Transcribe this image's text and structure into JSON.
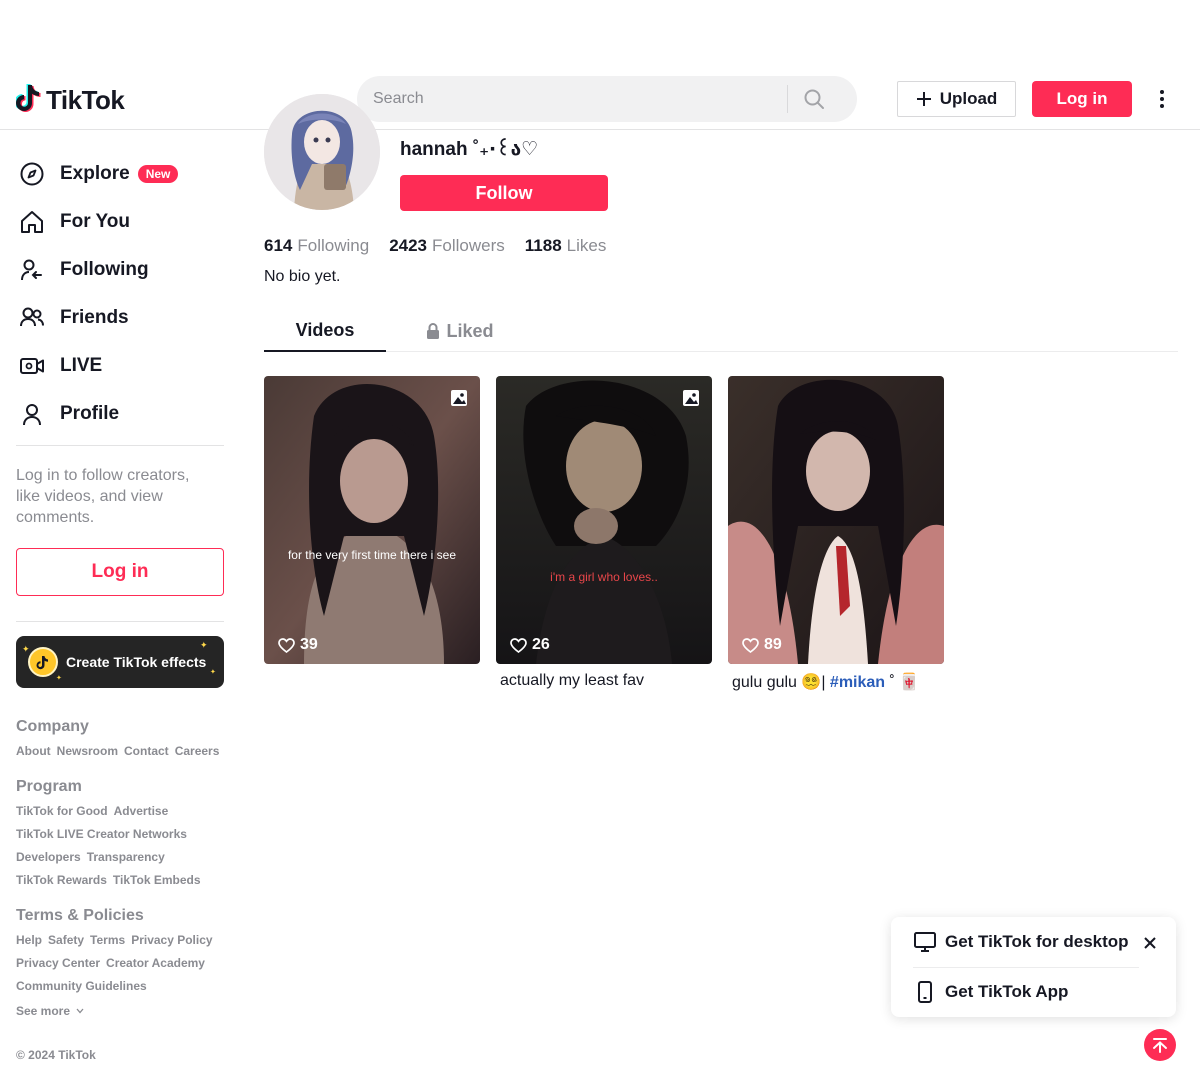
{
  "header": {
    "logo_text": "TikTok",
    "search_placeholder": "Search",
    "upload_label": "Upload",
    "login_label": "Log in"
  },
  "sidebar": {
    "items": [
      {
        "label": "Explore",
        "icon": "compass-icon",
        "badge": "New"
      },
      {
        "label": "For You",
        "icon": "home-icon"
      },
      {
        "label": "Following",
        "icon": "following-icon"
      },
      {
        "label": "Friends",
        "icon": "friends-icon"
      },
      {
        "label": "LIVE",
        "icon": "live-icon"
      },
      {
        "label": "Profile",
        "icon": "profile-icon"
      }
    ],
    "login_hint": "Log in to follow creators, like videos, and view comments.",
    "login_label": "Log in",
    "effects_label": "Create TikTok effects",
    "footer": {
      "company_heading": "Company",
      "company_links": [
        "About",
        "Newsroom",
        "Contact",
        "Careers"
      ],
      "program_heading": "Program",
      "program_lines": [
        [
          "TikTok for Good",
          "Advertise"
        ],
        [
          "TikTok LIVE Creator Networks"
        ],
        [
          "Developers",
          "Transparency"
        ],
        [
          "TikTok Rewards",
          "TikTok Embeds"
        ]
      ],
      "terms_heading": "Terms & Policies",
      "terms_lines": [
        [
          "Help",
          "Safety",
          "Terms",
          "Privacy Policy"
        ],
        [
          "Privacy Center",
          "Creator Academy"
        ],
        [
          "Community Guidelines"
        ]
      ],
      "see_more": "See more",
      "copyright": "© 2024 TikTok"
    }
  },
  "profile": {
    "username": "hannah ˚₊‧꒰ა♡",
    "follow_label": "Follow",
    "stats": [
      {
        "value": "614",
        "label": "Following"
      },
      {
        "value": "2423",
        "label": "Followers"
      },
      {
        "value": "1188",
        "label": "Likes"
      }
    ],
    "bio": "No bio yet.",
    "tabs": {
      "videos": "Videos",
      "liked": "Liked"
    }
  },
  "videos": [
    {
      "likes": "39",
      "overlay_text": "for the very first time there i see",
      "overlay_color": "#ffffff",
      "description": "",
      "is_photo": true
    },
    {
      "likes": "26",
      "overlay_text": "i'm a girl who loves..",
      "overlay_color": "#e8464a",
      "description": "actually my least fav",
      "is_photo": true
    },
    {
      "likes": "89",
      "overlay_text": "",
      "overlay_color": "#ffffff",
      "description_prefix": "gulu gulu 😵‍💫| ",
      "description_hashtag": "#mikan",
      "description_suffix": " ˚ 🀄",
      "is_photo": false
    }
  ],
  "popup": {
    "desktop_label": "Get TikTok for desktop",
    "app_label": "Get TikTok App"
  },
  "colors": {
    "brand": "#fe2c55",
    "text": "#161823",
    "muted": "#8a8b91",
    "hashtag": "#2b5db9"
  }
}
